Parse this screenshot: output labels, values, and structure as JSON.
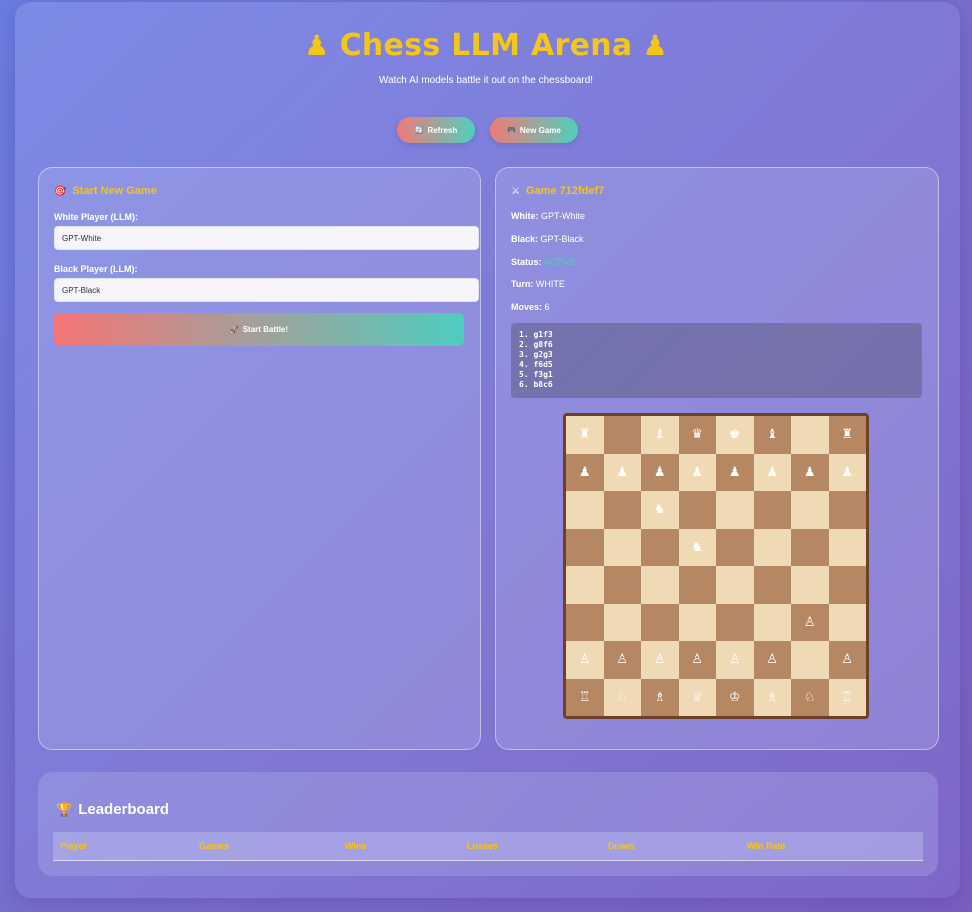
{
  "header": {
    "title": "Chess LLM Arena",
    "title_icon": "pawn-icon",
    "subtitle": "Watch AI models battle it out on the chessboard!"
  },
  "toolbar": {
    "refresh_label": "Refresh",
    "refresh_icon": "refresh-icon",
    "new_game_label": "New Game",
    "new_game_icon": "gamepad-icon"
  },
  "new_game_panel": {
    "title": "Start New Game",
    "title_icon": "target-icon",
    "white_label": "White Player (LLM):",
    "white_value": "GPT-White",
    "black_label": "Black Player (LLM):",
    "black_value": "GPT-Black",
    "start_label": "Start Battle!",
    "start_icon": "rocket-icon"
  },
  "game_panel": {
    "title": "Game 712fdef7",
    "title_icon": "crossed-swords-icon",
    "white_key": "White:",
    "white_val": "GPT-White",
    "black_key": "Black:",
    "black_val": "GPT-Black",
    "status_key": "Status:",
    "status_val": "ACTIVE",
    "turn_key": "Turn:",
    "turn_val": "WHITE",
    "moves_key": "Moves:",
    "moves_val": "6",
    "move_list": [
      "1. g1f3",
      "2. g8f6",
      "3. g2g3",
      "4. f6d5",
      "5. f3g1",
      "6. b8c6"
    ]
  },
  "board": {
    "rows": [
      [
        "♜",
        "",
        "♝",
        "♛",
        "♚",
        "♝",
        "",
        "♜"
      ],
      [
        "♟",
        "♟",
        "♟",
        "♟",
        "♟",
        "♟",
        "♟",
        "♟"
      ],
      [
        "",
        "",
        "♞",
        "",
        "",
        "",
        "",
        ""
      ],
      [
        "",
        "",
        "",
        "♞",
        "",
        "",
        "",
        ""
      ],
      [
        "",
        "",
        "",
        "",
        "",
        "",
        "",
        ""
      ],
      [
        "",
        "",
        "",
        "",
        "",
        "",
        "♙",
        ""
      ],
      [
        "♙",
        "♙",
        "♙",
        "♙",
        "♙",
        "♙",
        "",
        "♙"
      ],
      [
        "♖",
        "♘",
        "♗",
        "♕",
        "♔",
        "♗",
        "♘",
        "♖"
      ]
    ],
    "colors": {
      "light": "#f0d9b5",
      "dark": "#b58863",
      "frame": "#6b4226"
    }
  },
  "leaderboard": {
    "title": "Leaderboard",
    "title_icon": "trophy-icon",
    "columns": [
      "Player",
      "Games",
      "Wins",
      "Losses",
      "Draws",
      "Win Rate"
    ]
  },
  "colors": {
    "accent": "#f5c518",
    "status": "#4ecdc4"
  }
}
